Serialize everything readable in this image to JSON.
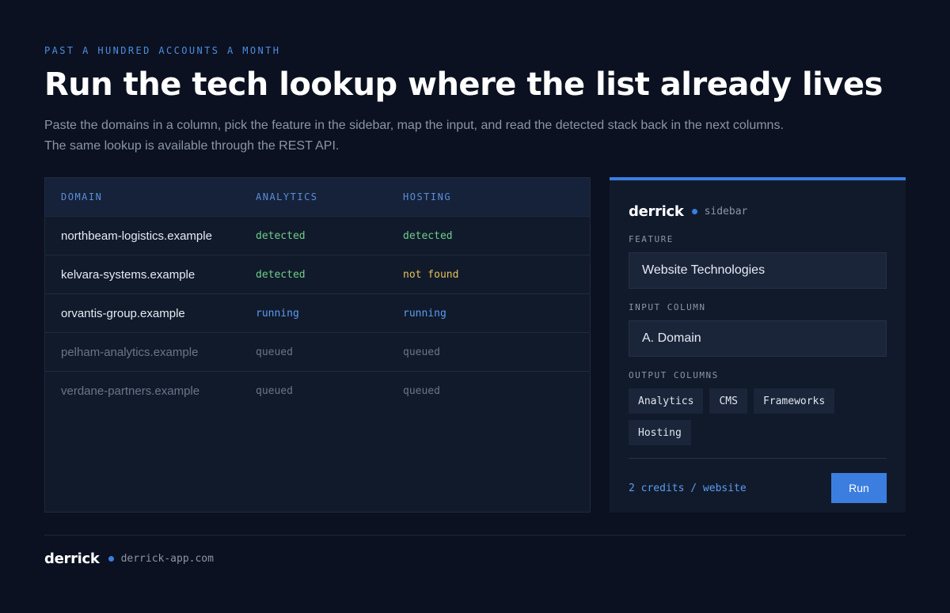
{
  "hero": {
    "eyebrow": "PAST A HUNDRED ACCOUNTS A MONTH",
    "title": "Run the tech lookup where the list already lives",
    "subtitle": "Paste the domains in a column, pick the feature in the sidebar, map the input, and read the detected stack back in the next columns. The same lookup is available through the REST API."
  },
  "table": {
    "headers": [
      "DOMAIN",
      "ANALYTICS",
      "HOSTING"
    ],
    "rows": [
      {
        "domain": "northbeam-logistics.example",
        "analytics": "detected",
        "hosting": "detected"
      },
      {
        "domain": "kelvara-systems.example",
        "analytics": "detected",
        "hosting": "not found"
      },
      {
        "domain": "orvantis-group.example",
        "analytics": "running",
        "hosting": "running"
      },
      {
        "domain": "pelham-analytics.example",
        "analytics": "queued",
        "hosting": "queued"
      },
      {
        "domain": "verdane-partners.example",
        "analytics": "queued",
        "hosting": "queued"
      }
    ]
  },
  "sidebar": {
    "brand": "derrick",
    "brand_sub": "sidebar",
    "feature_label": "FEATURE",
    "feature_value": "Website Technologies",
    "input_label": "INPUT COLUMN",
    "input_value": "A. Domain",
    "output_label": "OUTPUT COLUMNS",
    "output_columns": [
      "Analytics",
      "CMS",
      "Frameworks",
      "Hosting"
    ],
    "credits": "2 credits / website",
    "run_label": "Run"
  },
  "footer": {
    "brand": "derrick",
    "url": "derrick-app.com"
  },
  "colors": {
    "background": "#0b1120",
    "accent": "#3b7ee0",
    "detected": "#6fcf8a",
    "not_found": "#e6c15a",
    "running": "#5b9cf0",
    "queued": "#6b7588"
  }
}
